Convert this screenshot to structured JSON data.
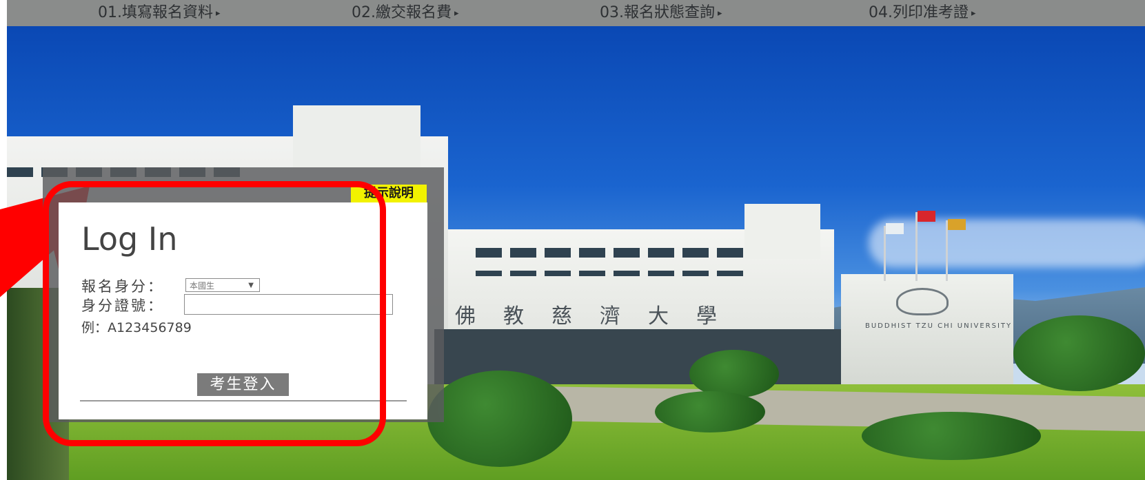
{
  "steps": [
    {
      "label": "01.填寫報名資料"
    },
    {
      "label": "02.繳交報名費"
    },
    {
      "label": "03.報名狀態查詢"
    },
    {
      "label": "04.列印准考證"
    }
  ],
  "step_arrow": "▸",
  "help_label": "提示說明",
  "login": {
    "title": "Log In",
    "identity_label": "報名身分：",
    "identity_selected": "本國生",
    "id_label": "身分證號：",
    "id_value": "",
    "example": "例：A123456789",
    "submit_label": "考生登入"
  },
  "photo": {
    "sign_text": "佛教慈濟大學",
    "sign_en": "BUDDHIST TZU CHI UNIVERSITY"
  },
  "colors": {
    "nav_bg": "#8a8c8b",
    "highlight": "#ff0000",
    "help_bg": "#f2f200",
    "button_bg": "#7b7b7b"
  }
}
